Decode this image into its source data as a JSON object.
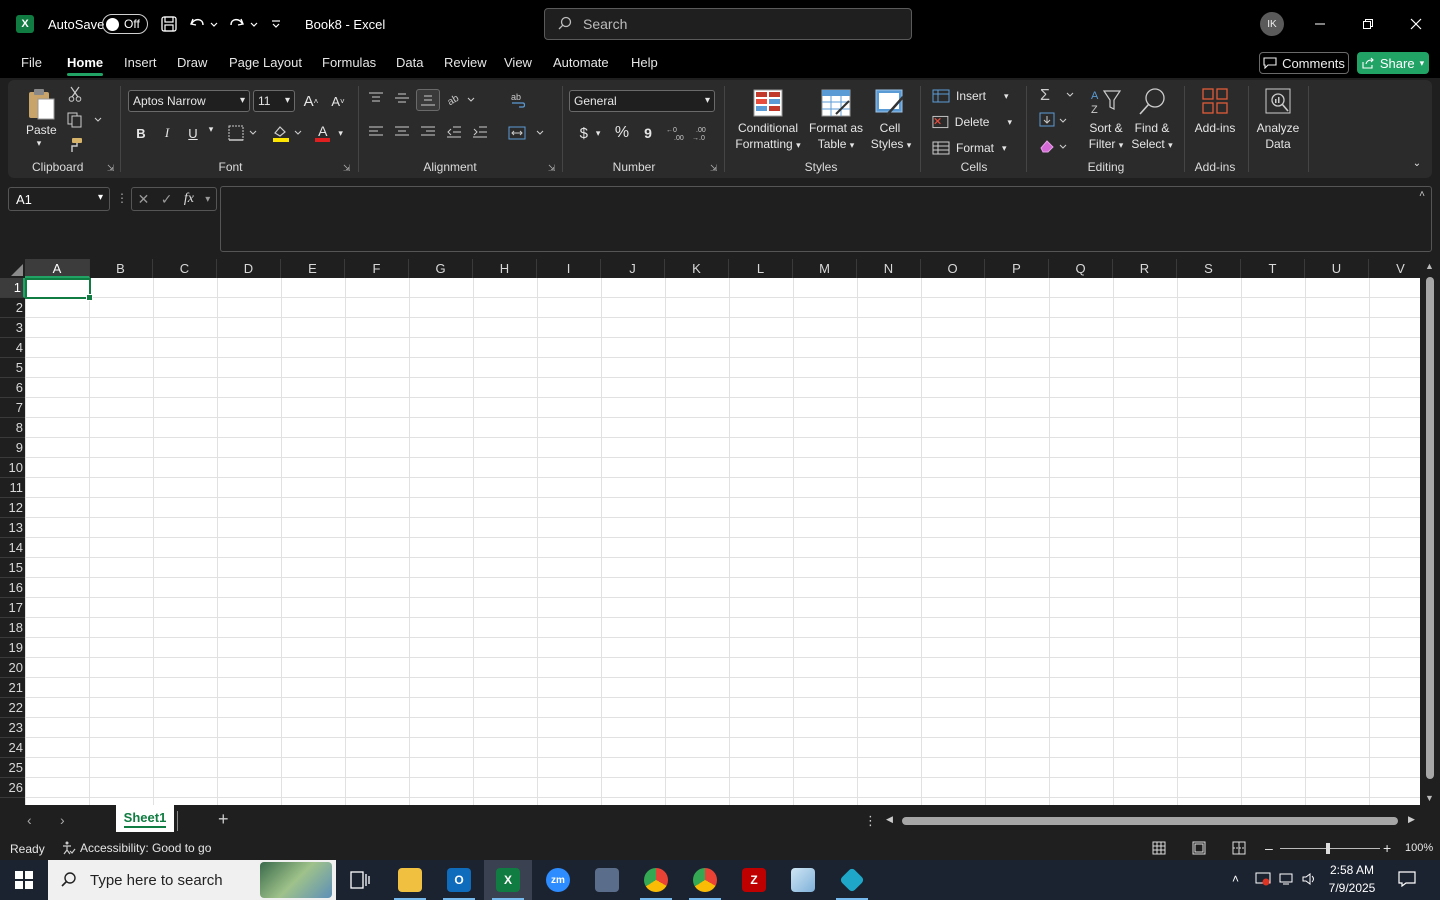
{
  "titlebar": {
    "autosave_label": "AutoSave",
    "autosave_state": "Off",
    "doc_title": "Book8  -  Excel",
    "search_placeholder": "Search",
    "user_initials": "IK"
  },
  "menu": {
    "tabs": [
      "File",
      "Home",
      "Insert",
      "Draw",
      "Page Layout",
      "Formulas",
      "Data",
      "Review",
      "View",
      "Automate",
      "Help"
    ],
    "active": "Home",
    "comments_label": "Comments",
    "share_label": "Share"
  },
  "ribbon": {
    "clipboard": {
      "paste_label": "Paste",
      "group_label": "Clipboard"
    },
    "font": {
      "font_name": "Aptos Narrow",
      "font_size": "11",
      "bold": "B",
      "italic": "I",
      "underline": "U",
      "grow": "A",
      "shrink": "A",
      "font_color_letter": "A",
      "group_label": "Font"
    },
    "alignment": {
      "group_label": "Alignment"
    },
    "number": {
      "format": "General",
      "currency": "$",
      "percent": "%",
      "comma": "9",
      "group_label": "Number"
    },
    "styles": {
      "conditional_line1": "Conditional",
      "conditional_line2": "Formatting",
      "format_table_line1": "Format as",
      "format_table_line2": "Table",
      "cell_styles_line1": "Cell",
      "cell_styles_line2": "Styles",
      "group_label": "Styles"
    },
    "cells": {
      "insert_label": "Insert",
      "delete_label": "Delete",
      "format_label": "Format",
      "group_label": "Cells"
    },
    "editing": {
      "sort_line1": "Sort &",
      "sort_line2": "Filter",
      "find_line1": "Find &",
      "find_line2": "Select",
      "group_label": "Editing"
    },
    "addins": {
      "addins_label": "Add-ins",
      "analyze_line1": "Analyze",
      "analyze_line2": "Data",
      "group_label": "Add-ins"
    },
    "accent_color": "#21a366"
  },
  "formula_bar": {
    "name_box": "A1",
    "fx": "fx",
    "value": ""
  },
  "grid": {
    "columns": [
      "A",
      "B",
      "C",
      "D",
      "E",
      "F",
      "G",
      "H",
      "I",
      "J",
      "K",
      "L",
      "M",
      "N",
      "O",
      "P",
      "Q",
      "R",
      "S",
      "T",
      "U",
      "V"
    ],
    "rows": [
      "1",
      "2",
      "3",
      "4",
      "5",
      "6",
      "7",
      "8",
      "9",
      "10",
      "11",
      "12",
      "13",
      "14",
      "15",
      "16",
      "17",
      "18",
      "19",
      "20",
      "21",
      "22",
      "23",
      "24",
      "25",
      "26"
    ],
    "active_cell": "A1"
  },
  "sheets": {
    "tabs": [
      "Sheet1"
    ],
    "active": "Sheet1"
  },
  "statusbar": {
    "mode": "Ready",
    "accessibility": "Accessibility: Good to go",
    "zoom": "100%"
  },
  "taskbar": {
    "search_placeholder": "Type here to search",
    "time": "2:58 AM",
    "date": "7/9/2025"
  }
}
